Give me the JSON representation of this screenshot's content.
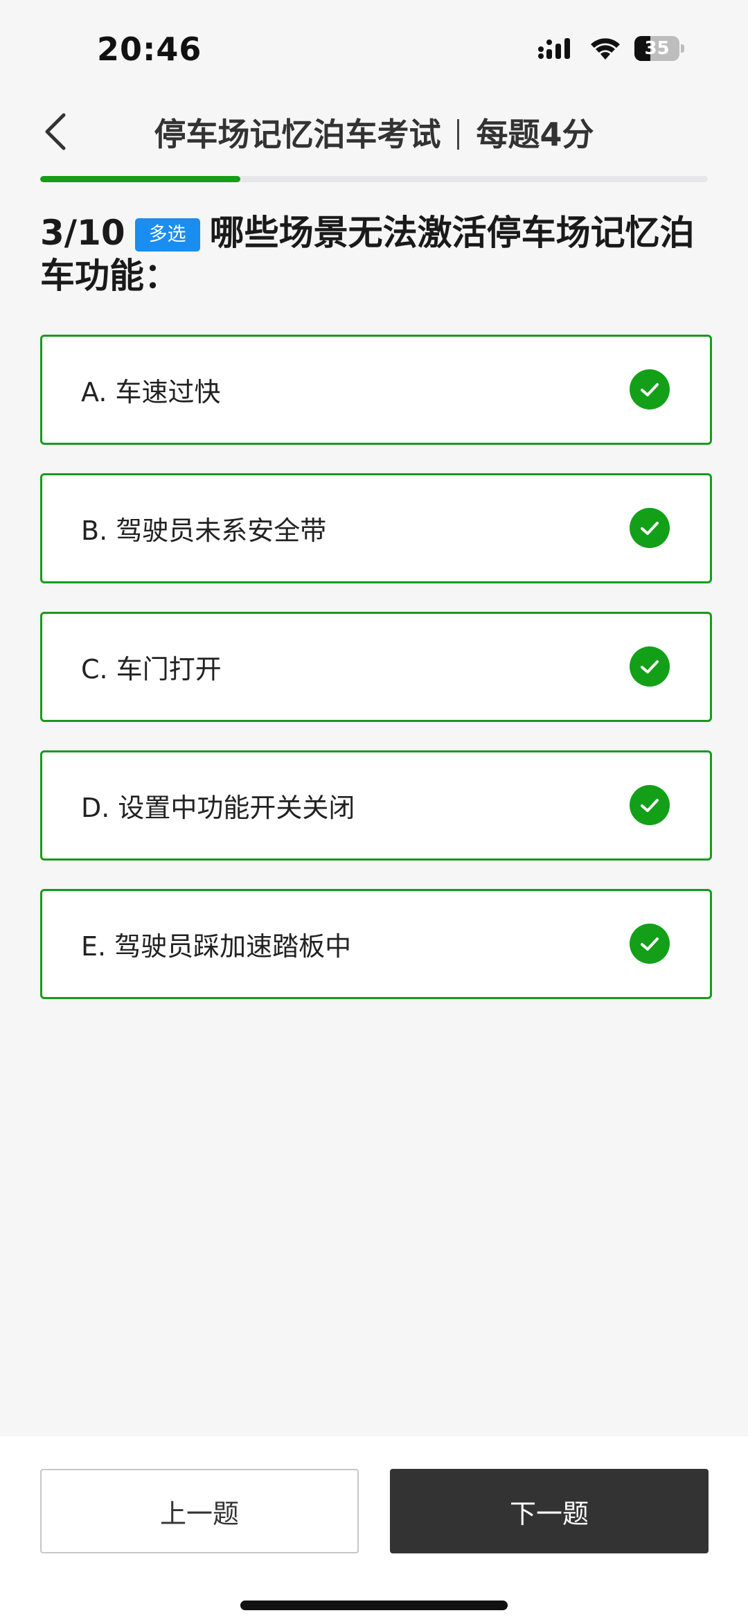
{
  "status_bar": {
    "time": "20:46",
    "battery_level": "35",
    "battery_fraction": 0.35
  },
  "header": {
    "title": "停车场记忆泊车考试",
    "score_rule": "每题4分",
    "back_icon": "chevron-left-icon"
  },
  "progress": {
    "fraction": 0.3
  },
  "question": {
    "number": "3/10",
    "type_tag": "多选",
    "text": "哪些场景无法激活停车场记忆泊车功能："
  },
  "options": [
    {
      "label": "A. 车速过快",
      "selected": true
    },
    {
      "label": "B. 驾驶员未系安全带",
      "selected": true
    },
    {
      "label": "C. 车门打开",
      "selected": true
    },
    {
      "label": "D. 设置中功能开关关闭",
      "selected": true
    },
    {
      "label": "E. 驾驶员踩加速踏板中",
      "selected": true
    }
  ],
  "footer": {
    "prev_label": "上一题",
    "next_label": "下一题"
  },
  "colors": {
    "accent_green": "#13a018",
    "tag_blue": "#1a8df0",
    "dark_button": "#333333"
  }
}
